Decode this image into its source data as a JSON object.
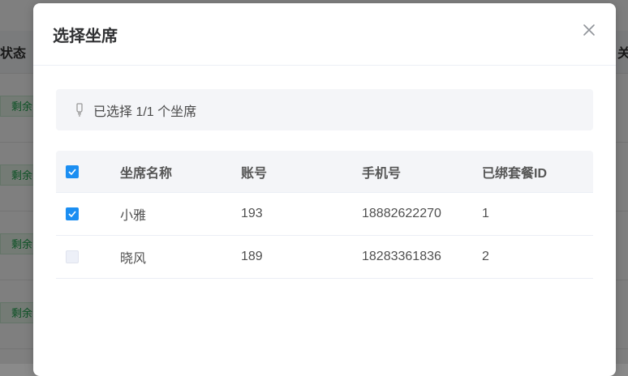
{
  "background": {
    "col_left_label": "状态",
    "col_right_label": "关",
    "row_tag": "剩余"
  },
  "dialog": {
    "title": "选择坐席",
    "close_icon": "close-icon",
    "info": {
      "icon": "lightbulb-icon",
      "text": "已选择 1/1 个坐席"
    },
    "table": {
      "columns": [
        "坐席名称",
        "账号",
        "手机号",
        "已绑套餐ID"
      ],
      "header_checked": true,
      "rows": [
        {
          "checked": true,
          "disabled": false,
          "name": "小雅",
          "account": "193",
          "phone": "18882622270",
          "package_id": "1"
        },
        {
          "checked": false,
          "disabled": true,
          "name": "晓风",
          "account": "189",
          "phone": "18283361836",
          "package_id": "2"
        }
      ]
    }
  },
  "colors": {
    "primary": "#1b8ef2",
    "tag_green": "#1aa34a",
    "overlay": "rgba(0,0,0,0.5)"
  }
}
